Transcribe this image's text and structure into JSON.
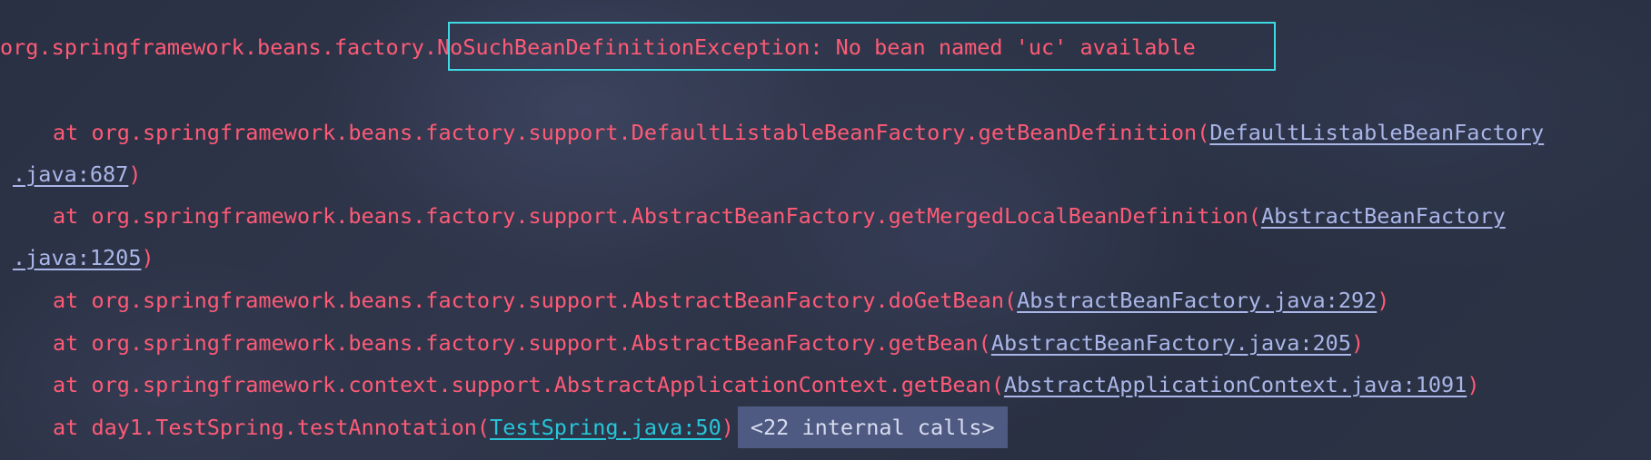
{
  "colors": {
    "background": "#2b3244",
    "error_text": "#ff5a76",
    "link": "#aab6e8",
    "link_active": "#27c6da",
    "highlight_border": "#3fd9e3",
    "internal_calls_bg": "#4f5a82"
  },
  "exception": {
    "prefix": "org.springframework.beans.factory",
    "message": ".NoSuchBeanDefinitionException: No bean named 'uc' available"
  },
  "stack": [
    {
      "text": "at org.springframework.beans.factory.support.DefaultListableBeanFactory.getBeanDefinition(",
      "link_part1": "DefaultListableBeanFactory",
      "link_part2": ".java:687",
      "suffix": ")"
    },
    {
      "text": "at org.springframework.beans.factory.support.AbstractBeanFactory.getMergedLocalBeanDefinition(",
      "link_part1": "AbstractBeanFactory",
      "link_part2": ".java:1205",
      "suffix": ")"
    },
    {
      "text": "at org.springframework.beans.factory.support.AbstractBeanFactory.doGetBean(",
      "link": "AbstractBeanFactory.java:292",
      "suffix": ")"
    },
    {
      "text": "at org.springframework.beans.factory.support.AbstractBeanFactory.getBean(",
      "link": "AbstractBeanFactory.java:205",
      "suffix": ")"
    },
    {
      "text": "at org.springframework.context.support.AbstractApplicationContext.getBean(",
      "link": "AbstractApplicationContext.java:1091",
      "suffix": ")"
    },
    {
      "text": "at day1.TestSpring.testAnnotation(",
      "link": "TestSpring.java:50",
      "suffix": ")",
      "internal_calls": "<22 internal calls>"
    }
  ]
}
